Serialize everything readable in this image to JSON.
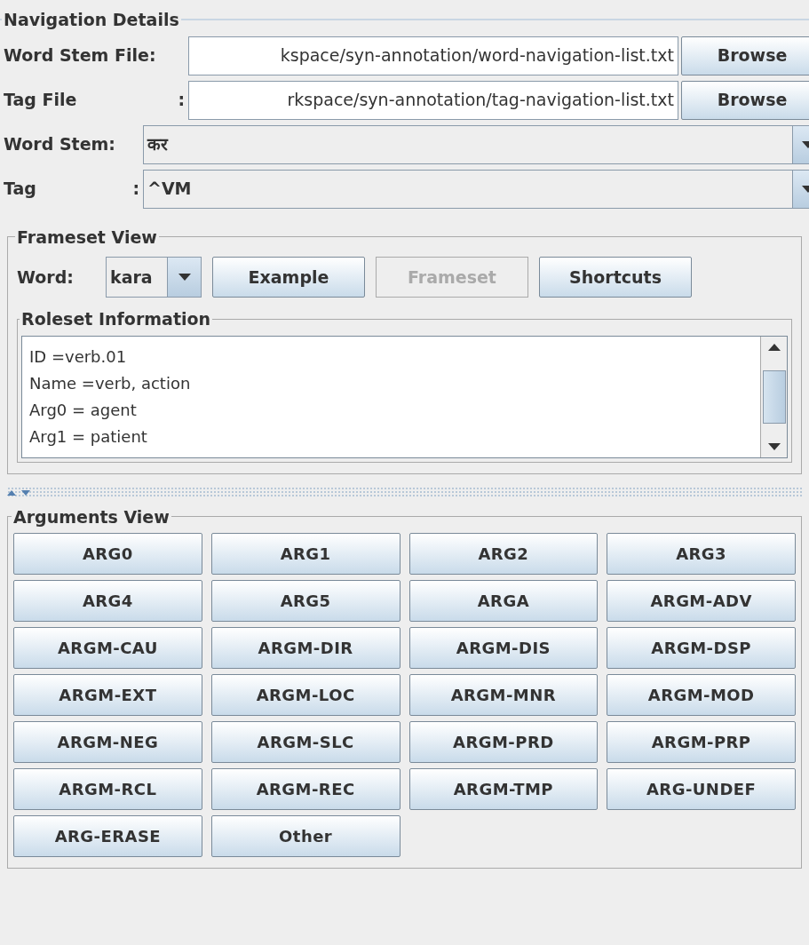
{
  "navigation": {
    "title": "Navigation Details",
    "file_fields": [
      {
        "label": "Word Stem File:",
        "value": "kspace/syn-annotation/word-navigation-list.txt",
        "button": "Browse"
      },
      {
        "label": "Tag File",
        "colon": ":",
        "value": "rkspace/syn-annotation/tag-navigation-list.txt",
        "button": "Browse"
      }
    ],
    "combos": [
      {
        "label": "Word Stem:",
        "value": "कर"
      },
      {
        "label": "Tag",
        "colon": ":",
        "value": "^VM"
      }
    ]
  },
  "frameset": {
    "title": "Frameset View",
    "word_label": "Word:",
    "word_value": "kara",
    "buttons": [
      {
        "label": "Example",
        "disabled": false
      },
      {
        "label": "Frameset",
        "disabled": true
      },
      {
        "label": "Shortcuts",
        "disabled": false
      }
    ],
    "roleset": {
      "title": "Roleset Information",
      "lines": [
        "ID =verb.01",
        "Name =verb, action",
        "Arg0 = agent",
        "Arg1 = patient"
      ]
    }
  },
  "arguments": {
    "title": "Arguments View",
    "buttons": [
      "ARG0",
      "ARG1",
      "ARG2",
      "ARG3",
      "ARG4",
      "ARG5",
      "ARGA",
      "ARGM-ADV",
      "ARGM-CAU",
      "ARGM-DIR",
      "ARGM-DIS",
      "ARGM-DSP",
      "ARGM-EXT",
      "ARGM-LOC",
      "ARGM-MNR",
      "ARGM-MOD",
      "ARGM-NEG",
      "ARGM-SLC",
      "ARGM-PRD",
      "ARGM-PRP",
      "ARGM-RCL",
      "ARGM-REC",
      "ARGM-TMP",
      "ARG-UNDEF",
      "ARG-ERASE",
      "Other"
    ]
  }
}
